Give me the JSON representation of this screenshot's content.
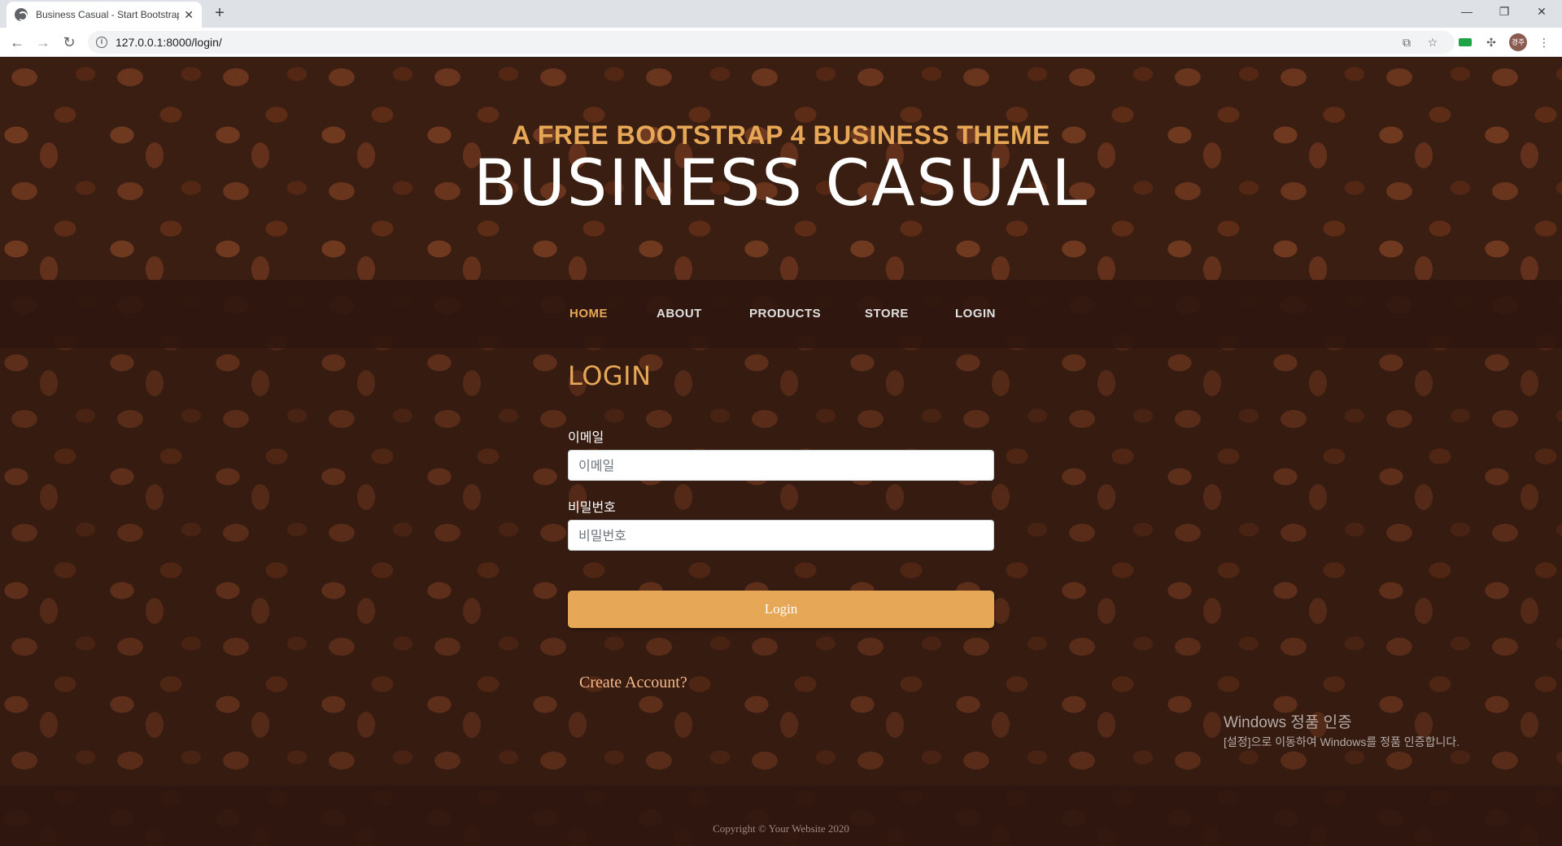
{
  "browser": {
    "tab_title": "Business Casual - Start Bootstrap Theme",
    "tab_close": "✕",
    "new_tab": "+",
    "url": "127.0.0.1:8000/login/",
    "avatar_text": "경주",
    "window_controls": {
      "minimize": "—",
      "maximize": "❐",
      "close": "✕"
    }
  },
  "header": {
    "subheading": "A FREE BOOTSTRAP 4 BUSINESS THEME",
    "heading": "BUSINESS CASUAL"
  },
  "nav": {
    "items": [
      {
        "label": "HOME",
        "active": true
      },
      {
        "label": "ABOUT",
        "active": false
      },
      {
        "label": "PRODUCTS",
        "active": false
      },
      {
        "label": "STORE",
        "active": false
      },
      {
        "label": "LOGIN",
        "active": false
      }
    ]
  },
  "login": {
    "title": "LOGIN",
    "email_label": "이메일",
    "email_placeholder": "이메일",
    "password_label": "비밀번호",
    "password_placeholder": "비밀번호",
    "submit_label": "Login",
    "create_account": "Create Account?"
  },
  "footer": {
    "copyright": "Copyright © Your Website 2020"
  },
  "watermark": {
    "line1": "Windows 정품 인증",
    "line2": "[설정]으로 이동하여 Windows를 정품 인증합니다."
  },
  "colors": {
    "accent": "#e6a756",
    "nav_bg": "#2f170f",
    "link": "#f6b98a"
  }
}
